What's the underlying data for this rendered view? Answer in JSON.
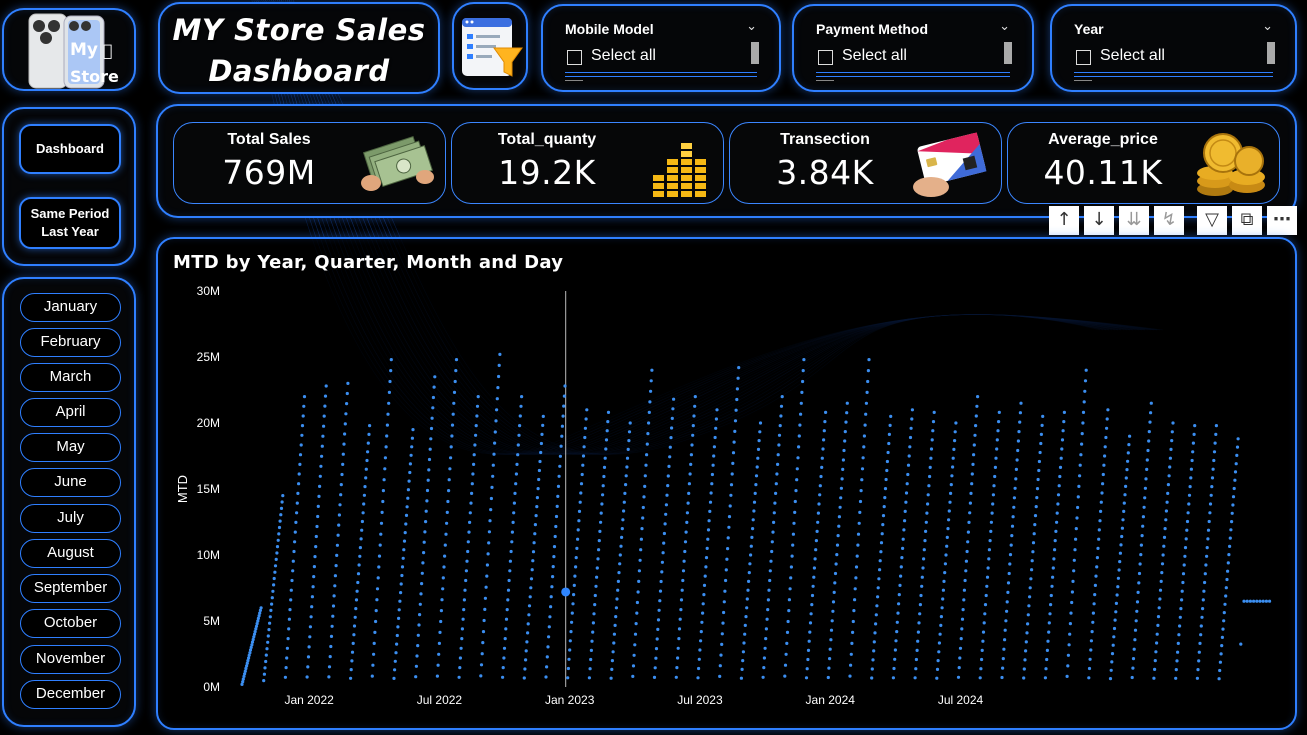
{
  "logo": {
    "line1": "My",
    "line2": "Store"
  },
  "title": {
    "line1": "MY Store Sales",
    "line2": "Dashboard"
  },
  "slicers": [
    {
      "label": "Mobile Model",
      "option": "Select all"
    },
    {
      "label": "Payment Method",
      "option": "Select all"
    },
    {
      "label": "Year",
      "option": "Select all"
    }
  ],
  "nav": {
    "dashboard": "Dashboard",
    "spl_line1": "Same Period",
    "spl_line2": "Last Year"
  },
  "months": [
    "January",
    "February",
    "March",
    "April",
    "May",
    "June",
    "July",
    "August",
    "September",
    "October",
    "November",
    "December"
  ],
  "kpis": [
    {
      "label": "Total Sales",
      "value": "769M",
      "icon": "money-icon"
    },
    {
      "label": "Total_quanty",
      "value": "19.2K",
      "icon": "bar-stack-icon"
    },
    {
      "label": "Transection",
      "value": "3.84K",
      "icon": "credit-card-icon"
    },
    {
      "label": "Average_price",
      "value": "40.11K",
      "icon": "gold-coins-icon"
    }
  ],
  "colors": {
    "accent": "#2f7fff",
    "series": "#3b8ef0"
  },
  "chart_data": {
    "type": "scatter",
    "title": "MTD by Year, Quarter, Month and Day",
    "ylabel": "MTD",
    "xlabel": "",
    "ylim": [
      0,
      30
    ],
    "y_unit": "M",
    "yticks": [
      "0M",
      "5M",
      "10M",
      "15M",
      "20M",
      "25M",
      "30M"
    ],
    "xticks": [
      "Jan 2022",
      "Jul 2022",
      "Jan 2023",
      "Jul 2023",
      "Jan 2024",
      "Jul 2024"
    ],
    "grid": false,
    "series": [
      {
        "x_start": "2021-10",
        "monthly_peak_mtd_millions": [
          6.0,
          14.5,
          22.0,
          22.8,
          23.0,
          19.8,
          24.8,
          19.5,
          23.5,
          24.8,
          22.0,
          25.2,
          22.0,
          20.5,
          22.8,
          21.0,
          20.8,
          20.0,
          24.0,
          21.8,
          22.0,
          21.0,
          24.2,
          20.0,
          22.0,
          24.8,
          20.8,
          21.5,
          24.8,
          20.5,
          21.0,
          20.8,
          20.0,
          22.0,
          20.8,
          21.5,
          20.5,
          20.8,
          24.0,
          21.0,
          19.0,
          21.5,
          20.0,
          19.8,
          19.8,
          18.8
        ],
        "last_month_mtd_millions": 6.5
      }
    ],
    "highlight": {
      "x": "Jan 2023",
      "value_millions": 7.2
    }
  }
}
